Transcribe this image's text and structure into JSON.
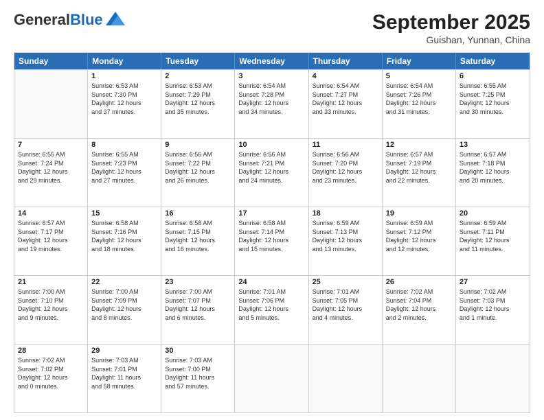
{
  "header": {
    "logo_general": "General",
    "logo_blue": "Blue",
    "month_title": "September 2025",
    "location": "Guishan, Yunnan, China"
  },
  "weekdays": [
    "Sunday",
    "Monday",
    "Tuesday",
    "Wednesday",
    "Thursday",
    "Friday",
    "Saturday"
  ],
  "rows": [
    [
      {
        "day": "",
        "info": ""
      },
      {
        "day": "1",
        "info": "Sunrise: 6:53 AM\nSunset: 7:30 PM\nDaylight: 12 hours\nand 37 minutes."
      },
      {
        "day": "2",
        "info": "Sunrise: 6:53 AM\nSunset: 7:29 PM\nDaylight: 12 hours\nand 35 minutes."
      },
      {
        "day": "3",
        "info": "Sunrise: 6:54 AM\nSunset: 7:28 PM\nDaylight: 12 hours\nand 34 minutes."
      },
      {
        "day": "4",
        "info": "Sunrise: 6:54 AM\nSunset: 7:27 PM\nDaylight: 12 hours\nand 33 minutes."
      },
      {
        "day": "5",
        "info": "Sunrise: 6:54 AM\nSunset: 7:26 PM\nDaylight: 12 hours\nand 31 minutes."
      },
      {
        "day": "6",
        "info": "Sunrise: 6:55 AM\nSunset: 7:25 PM\nDaylight: 12 hours\nand 30 minutes."
      }
    ],
    [
      {
        "day": "7",
        "info": "Sunrise: 6:55 AM\nSunset: 7:24 PM\nDaylight: 12 hours\nand 29 minutes."
      },
      {
        "day": "8",
        "info": "Sunrise: 6:55 AM\nSunset: 7:23 PM\nDaylight: 12 hours\nand 27 minutes."
      },
      {
        "day": "9",
        "info": "Sunrise: 6:56 AM\nSunset: 7:22 PM\nDaylight: 12 hours\nand 26 minutes."
      },
      {
        "day": "10",
        "info": "Sunrise: 6:56 AM\nSunset: 7:21 PM\nDaylight: 12 hours\nand 24 minutes."
      },
      {
        "day": "11",
        "info": "Sunrise: 6:56 AM\nSunset: 7:20 PM\nDaylight: 12 hours\nand 23 minutes."
      },
      {
        "day": "12",
        "info": "Sunrise: 6:57 AM\nSunset: 7:19 PM\nDaylight: 12 hours\nand 22 minutes."
      },
      {
        "day": "13",
        "info": "Sunrise: 6:57 AM\nSunset: 7:18 PM\nDaylight: 12 hours\nand 20 minutes."
      }
    ],
    [
      {
        "day": "14",
        "info": "Sunrise: 6:57 AM\nSunset: 7:17 PM\nDaylight: 12 hours\nand 19 minutes."
      },
      {
        "day": "15",
        "info": "Sunrise: 6:58 AM\nSunset: 7:16 PM\nDaylight: 12 hours\nand 18 minutes."
      },
      {
        "day": "16",
        "info": "Sunrise: 6:58 AM\nSunset: 7:15 PM\nDaylight: 12 hours\nand 16 minutes."
      },
      {
        "day": "17",
        "info": "Sunrise: 6:58 AM\nSunset: 7:14 PM\nDaylight: 12 hours\nand 15 minutes."
      },
      {
        "day": "18",
        "info": "Sunrise: 6:59 AM\nSunset: 7:13 PM\nDaylight: 12 hours\nand 13 minutes."
      },
      {
        "day": "19",
        "info": "Sunrise: 6:59 AM\nSunset: 7:12 PM\nDaylight: 12 hours\nand 12 minutes."
      },
      {
        "day": "20",
        "info": "Sunrise: 6:59 AM\nSunset: 7:11 PM\nDaylight: 12 hours\nand 11 minutes."
      }
    ],
    [
      {
        "day": "21",
        "info": "Sunrise: 7:00 AM\nSunset: 7:10 PM\nDaylight: 12 hours\nand 9 minutes."
      },
      {
        "day": "22",
        "info": "Sunrise: 7:00 AM\nSunset: 7:09 PM\nDaylight: 12 hours\nand 8 minutes."
      },
      {
        "day": "23",
        "info": "Sunrise: 7:00 AM\nSunset: 7:07 PM\nDaylight: 12 hours\nand 6 minutes."
      },
      {
        "day": "24",
        "info": "Sunrise: 7:01 AM\nSunset: 7:06 PM\nDaylight: 12 hours\nand 5 minutes."
      },
      {
        "day": "25",
        "info": "Sunrise: 7:01 AM\nSunset: 7:05 PM\nDaylight: 12 hours\nand 4 minutes."
      },
      {
        "day": "26",
        "info": "Sunrise: 7:02 AM\nSunset: 7:04 PM\nDaylight: 12 hours\nand 2 minutes."
      },
      {
        "day": "27",
        "info": "Sunrise: 7:02 AM\nSunset: 7:03 PM\nDaylight: 12 hours\nand 1 minute."
      }
    ],
    [
      {
        "day": "28",
        "info": "Sunrise: 7:02 AM\nSunset: 7:02 PM\nDaylight: 12 hours\nand 0 minutes."
      },
      {
        "day": "29",
        "info": "Sunrise: 7:03 AM\nSunset: 7:01 PM\nDaylight: 11 hours\nand 58 minutes."
      },
      {
        "day": "30",
        "info": "Sunrise: 7:03 AM\nSunset: 7:00 PM\nDaylight: 11 hours\nand 57 minutes."
      },
      {
        "day": "",
        "info": ""
      },
      {
        "day": "",
        "info": ""
      },
      {
        "day": "",
        "info": ""
      },
      {
        "day": "",
        "info": ""
      }
    ]
  ]
}
